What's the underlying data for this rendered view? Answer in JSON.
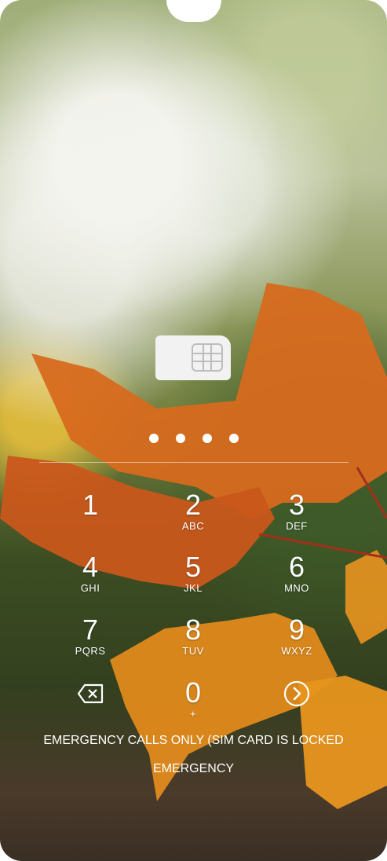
{
  "sim_icon": "sim-card-icon",
  "pin_dots": [
    1,
    1,
    1,
    1
  ],
  "keypad": [
    {
      "num": "1",
      "sub": ""
    },
    {
      "num": "2",
      "sub": "ABC"
    },
    {
      "num": "3",
      "sub": "DEF"
    },
    {
      "num": "4",
      "sub": "GHI"
    },
    {
      "num": "5",
      "sub": "JKL"
    },
    {
      "num": "6",
      "sub": "MNO"
    },
    {
      "num": "7",
      "sub": "PQRS"
    },
    {
      "num": "8",
      "sub": "TUV"
    },
    {
      "num": "9",
      "sub": "WXYZ"
    },
    {
      "num": "0",
      "sub": "+"
    }
  ],
  "delete_icon": "backspace-icon",
  "enter_icon": "arrow-right-circle-icon",
  "status_message": "EMERGENCY CALLS ONLY (SIM CARD IS LOCKED",
  "emergency_label": "EMERGENCY"
}
